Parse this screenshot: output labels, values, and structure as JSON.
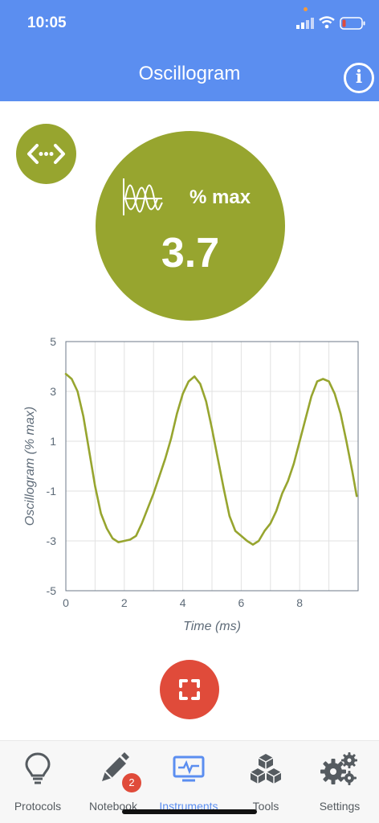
{
  "status_bar": {
    "time": "10:05"
  },
  "header": {
    "title": "Oscillogram",
    "info_symbol": "i"
  },
  "reading": {
    "unit": "% max",
    "value": "3.7"
  },
  "chart_data": {
    "type": "line",
    "xlabel": "Time (ms)",
    "ylabel": "Oscillogram (% max)",
    "xlim": [
      0,
      10
    ],
    "ylim": [
      -5,
      5
    ],
    "x_ticks": [
      "0",
      "2",
      "4",
      "6",
      "8"
    ],
    "y_ticks": [
      "5",
      "3",
      "1",
      "-1",
      "-3",
      "-5"
    ],
    "grid": true,
    "color": "#97a52f",
    "series": [
      {
        "x": [
          0,
          0.2,
          0.4,
          0.6,
          0.8,
          1.0,
          1.2,
          1.4,
          1.6,
          1.8,
          2.0,
          2.2,
          2.4,
          2.6,
          2.8,
          3.0,
          3.2,
          3.4,
          3.6,
          3.8,
          4.0,
          4.2,
          4.4,
          4.6,
          4.8,
          5.0,
          5.2,
          5.4,
          5.6,
          5.8,
          6.0,
          6.2,
          6.4,
          6.6,
          6.8,
          7.0,
          7.2,
          7.4,
          7.6,
          7.8,
          8.0,
          8.2,
          8.4,
          8.6,
          8.8,
          9.0,
          9.2,
          9.4,
          9.6,
          9.8,
          9.95
        ],
        "y": [
          3.7,
          3.5,
          3.0,
          2.0,
          0.6,
          -0.8,
          -1.9,
          -2.5,
          -2.9,
          -3.05,
          -3.0,
          -2.95,
          -2.8,
          -2.3,
          -1.7,
          -1.1,
          -0.4,
          0.3,
          1.1,
          2.1,
          2.9,
          3.4,
          3.6,
          3.3,
          2.6,
          1.5,
          0.3,
          -0.9,
          -2.0,
          -2.6,
          -2.8,
          -3.0,
          -3.15,
          -3.0,
          -2.6,
          -2.3,
          -1.8,
          -1.1,
          -0.6,
          0.1,
          1.0,
          1.9,
          2.8,
          3.4,
          3.5,
          3.4,
          2.9,
          2.1,
          1.0,
          -0.2,
          -1.2
        ]
      }
    ]
  },
  "tabs": [
    {
      "label": "Protocols",
      "icon": "lightbulb-icon"
    },
    {
      "label": "Notebook",
      "icon": "pen-icon",
      "badge": "2"
    },
    {
      "label": "Instruments",
      "icon": "monitor-pulse-icon"
    },
    {
      "label": "Tools",
      "icon": "cubes-icon"
    },
    {
      "label": "Settings",
      "icon": "gears-icon"
    }
  ],
  "colors": {
    "header": "#5b8ef0",
    "accent_green": "#97a52f",
    "capture_red": "#e04b3a"
  }
}
